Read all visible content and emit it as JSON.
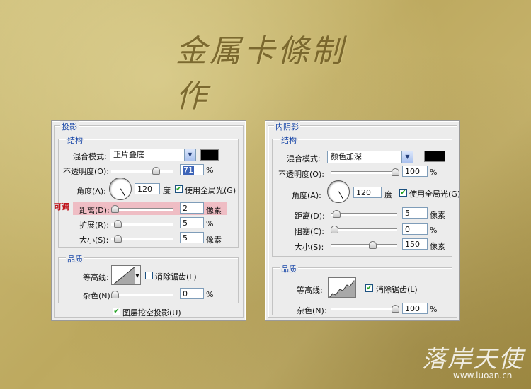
{
  "page_title": "金属卡條制作",
  "left_panel": {
    "section_title": "投影",
    "structure_title": "结构",
    "blend_label": "混合模式:",
    "blend_value": "正片叠底",
    "blend_color": "#000000",
    "opacity_label": "不透明度(O):",
    "opacity_value": "71",
    "opacity_unit": "%",
    "angle_label": "角度(A):",
    "angle_value": "120",
    "angle_unit": "度",
    "global_light_label": "使用全局光(G)",
    "global_light_checked": true,
    "distance_label": "距离(D):",
    "distance_value": "2",
    "distance_unit": "像素",
    "spread_label": "扩展(R):",
    "spread_value": "5",
    "spread_unit": "%",
    "size_label": "大小(S):",
    "size_value": "5",
    "size_unit": "像素",
    "quality_title": "品质",
    "contour_label": "等高线:",
    "antialias_label": "消除锯齿(L)",
    "antialias_checked": false,
    "noise_label": "杂色(N):",
    "noise_value": "0",
    "noise_unit": "%",
    "knockout_label": "图层挖空投影(U)",
    "knockout_checked": true,
    "side_note": "可调"
  },
  "right_panel": {
    "section_title": "内阴影",
    "structure_title": "结构",
    "blend_label": "混合模式:",
    "blend_value": "颜色加深",
    "blend_color": "#000000",
    "opacity_label": "不透明度(O):",
    "opacity_value": "100",
    "opacity_unit": "%",
    "angle_label": "角度(A):",
    "angle_value": "120",
    "angle_unit": "度",
    "global_light_label": "使用全局光(G)",
    "global_light_checked": true,
    "distance_label": "距离(D):",
    "distance_value": "5",
    "distance_unit": "像素",
    "choke_label": "阻塞(C):",
    "choke_value": "0",
    "choke_unit": "%",
    "size_label": "大小(S):",
    "size_value": "150",
    "size_unit": "像素",
    "quality_title": "品质",
    "contour_label": "等高线:",
    "antialias_label": "消除锯齿(L)",
    "antialias_checked": true,
    "noise_label": "杂色(N):",
    "noise_value": "100",
    "noise_unit": "%"
  },
  "watermark": {
    "brand": "落岸天使",
    "url": "www.luoan.cn"
  }
}
